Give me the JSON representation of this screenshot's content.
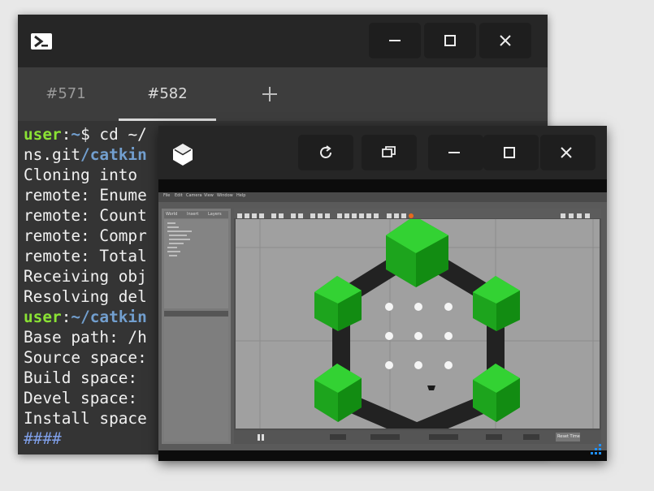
{
  "terminal": {
    "tabs": [
      {
        "label": "#571"
      },
      {
        "label": "#582"
      }
    ],
    "new_tab_icon": "plus-icon",
    "window_buttons": [
      "minimize-icon",
      "maximize-icon",
      "close-icon"
    ],
    "lines": [
      {
        "segments": [
          {
            "t": "user",
            "c": "u"
          },
          {
            "t": ":",
            "c": ""
          },
          {
            "t": "~",
            "c": "p"
          },
          {
            "t": "$ cd ~/",
            "c": ""
          }
        ]
      },
      {
        "segments": [
          {
            "t": "ns.git",
            "c": ""
          },
          {
            "t": "/catkin",
            "c": "p"
          }
        ]
      },
      {
        "segments": [
          {
            "t": "Cloning into ",
            "c": ""
          }
        ]
      },
      {
        "segments": [
          {
            "t": "remote: Enume",
            "c": ""
          }
        ]
      },
      {
        "segments": [
          {
            "t": "remote: Count",
            "c": ""
          }
        ]
      },
      {
        "segments": [
          {
            "t": "remote: Compr",
            "c": ""
          }
        ]
      },
      {
        "segments": [
          {
            "t": "remote: Total",
            "c": ""
          }
        ]
      },
      {
        "segments": [
          {
            "t": "Receiving obj",
            "c": ""
          }
        ]
      },
      {
        "segments": [
          {
            "t": "Resolving del",
            "c": ""
          }
        ]
      },
      {
        "segments": [
          {
            "t": "user",
            "c": "u"
          },
          {
            "t": ":",
            "c": ""
          },
          {
            "t": "~/catkin",
            "c": "p"
          }
        ]
      },
      {
        "segments": [
          {
            "t": "Base path: /h",
            "c": ""
          }
        ]
      },
      {
        "segments": [
          {
            "t": "Source space:",
            "c": ""
          }
        ]
      },
      {
        "segments": [
          {
            "t": "Build space: ",
            "c": ""
          }
        ]
      },
      {
        "segments": [
          {
            "t": "Devel space: ",
            "c": ""
          }
        ]
      },
      {
        "segments": [
          {
            "t": "Install space",
            "c": ""
          }
        ]
      },
      {
        "segments": [
          {
            "t": "####",
            "c": "b"
          }
        ]
      }
    ]
  },
  "gazebo": {
    "app_icon": "cube-icon",
    "window_buttons": [
      "refresh-icon",
      "restore-icon",
      "minimize-icon",
      "maximize-icon",
      "close-icon"
    ],
    "menu": [
      "File",
      "Edit",
      "Camera",
      "View",
      "Window",
      "Help"
    ],
    "panel_tabs": [
      "World",
      "Insert",
      "Layers"
    ],
    "pause_icon": "pause-icon",
    "reset_button": "Reset Time",
    "colors": {
      "ground": "#a2a2a2",
      "cube": "#1faa1f",
      "beam": "#222222",
      "marker": "#f5f5f5"
    }
  }
}
